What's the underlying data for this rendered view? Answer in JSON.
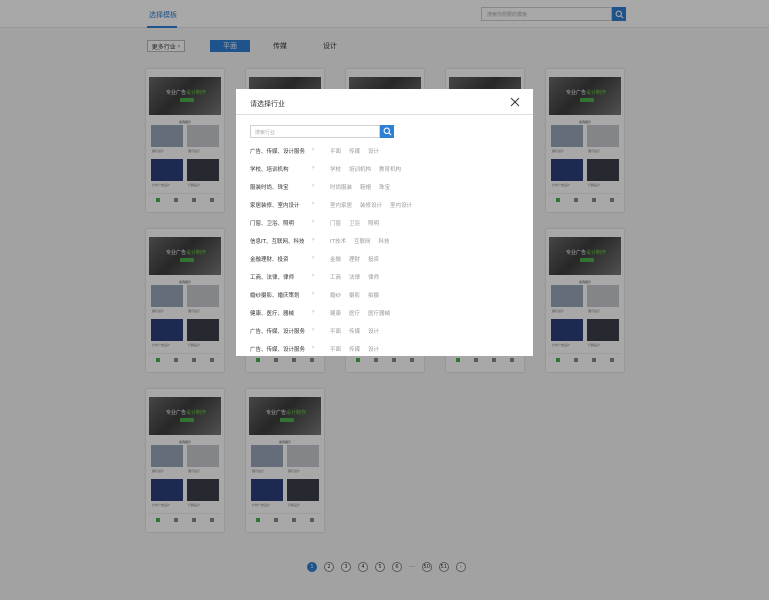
{
  "header": {
    "title": "选择模板",
    "search_placeholder": "搜索你想要的模板"
  },
  "filter": {
    "more_label": "更多行业",
    "categories": [
      "平面",
      "传媒",
      "设计"
    ]
  },
  "card": {
    "banner_text": "专业广告",
    "banner_highlight": "设计制作",
    "section_title": "案例展示",
    "captions": [
      "展示设计",
      "展示设计",
      "户外广告设计",
      "灯箱设计"
    ]
  },
  "modal": {
    "title": "请选择行业",
    "search_placeholder": "搜索行业",
    "rows": [
      {
        "group": "广告、传媒、设计服务",
        "tags": [
          "平面",
          "传媒",
          "设计"
        ]
      },
      {
        "group": "学校、培训机构",
        "tags": [
          "学校",
          "培训机构",
          "教育机构"
        ]
      },
      {
        "group": "服装时尚、珠宝",
        "tags": [
          "时尚服装",
          "鞋帽",
          "珠宝"
        ]
      },
      {
        "group": "家居装修、室内设计",
        "tags": [
          "室内家居",
          "装修设计",
          "室内设计"
        ]
      },
      {
        "group": "门窗、卫浴、照明",
        "tags": [
          "门窗",
          "卫浴",
          "照明"
        ]
      },
      {
        "group": "信息IT、互联网、科技",
        "tags": [
          "IT技术",
          "互联网",
          "科技"
        ]
      },
      {
        "group": "金融理财、投资",
        "tags": [
          "金融",
          "理财",
          "投资"
        ]
      },
      {
        "group": "工商、法律、律师",
        "tags": [
          "工商",
          "法律",
          "律师"
        ]
      },
      {
        "group": "婚纱摄影、婚庆策划",
        "tags": [
          "婚纱",
          "摄影",
          "拍摄"
        ]
      },
      {
        "group": "健康、医疗、器械",
        "tags": [
          "健康",
          "医疗",
          "医疗器械"
        ]
      },
      {
        "group": "广告、传媒、设计服务",
        "tags": [
          "平面",
          "传媒",
          "设计"
        ]
      },
      {
        "group": "广告、传媒、设计服务",
        "tags": [
          "平面",
          "传媒",
          "设计"
        ]
      }
    ]
  },
  "pagination": {
    "pages": [
      "1",
      "2",
      "3",
      "4",
      "5",
      "6"
    ],
    "ellipsis": "···",
    "last_pages": [
      "50",
      "51"
    ],
    "active": "1"
  },
  "colors": {
    "accent": "#2f7fd3",
    "banner_highlight": "#6bd24a"
  }
}
